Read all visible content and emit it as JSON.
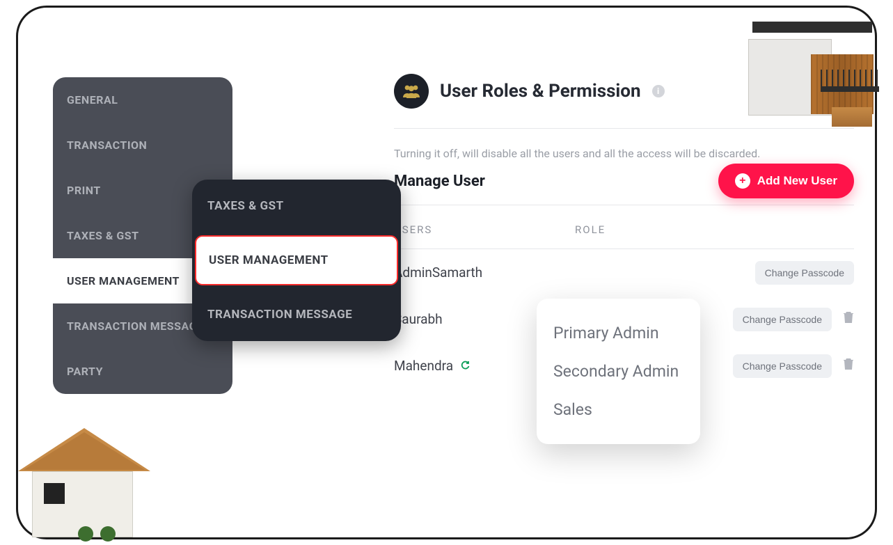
{
  "sidebar1": {
    "items": [
      {
        "label": "GENERAL"
      },
      {
        "label": "TRANSACTION"
      },
      {
        "label": "PRINT"
      },
      {
        "label": "TAXES & GST"
      },
      {
        "label": "USER MANAGEMENT"
      },
      {
        "label": "TRANSACTION MESSAGE"
      },
      {
        "label": "PARTY"
      }
    ],
    "activeIndex": 4
  },
  "sidebar2": {
    "items": [
      {
        "label": "TAXES & GST"
      },
      {
        "label": "USER MANAGEMENT"
      },
      {
        "label": "TRANSACTION MESSAGE"
      }
    ],
    "highlightedIndex": 1
  },
  "header": {
    "title": "User Roles & Permission",
    "info_tooltip": "i",
    "description": "Turning it off, will disable all the users and all the access will be discarded."
  },
  "manage": {
    "title": "Manage User",
    "add_button": "Add New User",
    "columns": {
      "users": "USERS",
      "role": "ROLE"
    },
    "change_passcode_label": "Change Passcode",
    "rows": [
      {
        "name": "AdminSamarth",
        "sync": false,
        "deletable": false
      },
      {
        "name": "Saurabh",
        "sync": false,
        "deletable": true
      },
      {
        "name": "Mahendra",
        "sync": true,
        "deletable": true
      }
    ]
  },
  "role_dropdown": {
    "options": [
      "Primary Admin",
      "Secondary Admin",
      "Sales"
    ]
  },
  "colors": {
    "accent": "#ff134a",
    "sidebar1_bg": "#4a4d56",
    "sidebar2_bg": "#22262f",
    "highlight_border": "#ff2b2b"
  }
}
